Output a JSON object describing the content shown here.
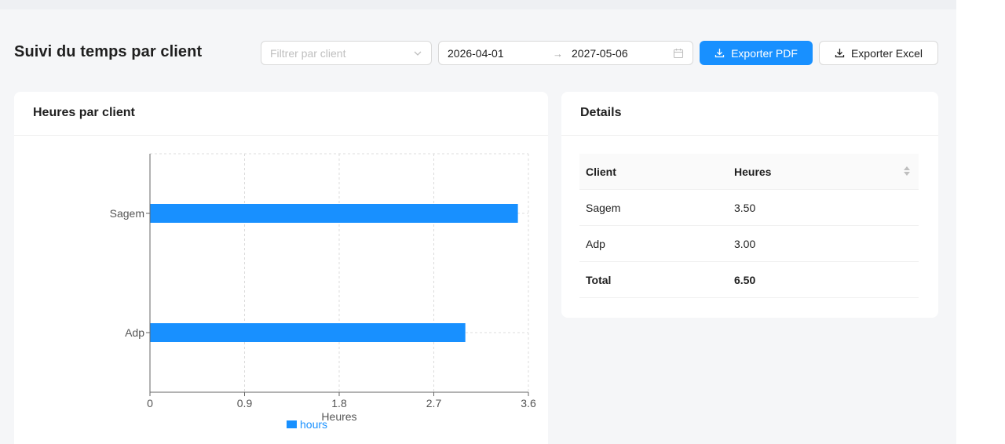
{
  "header": {
    "title": "Suivi du temps par client",
    "client_filter_placeholder": "Filtrer par client",
    "date_start": "2026-04-01",
    "date_end": "2027-05-06",
    "export_pdf_label": "Exporter PDF",
    "export_excel_label": "Exporter Excel"
  },
  "chart_card": {
    "title": "Heures par client"
  },
  "details_card": {
    "title": "Details",
    "columns": [
      "Client",
      "Heures"
    ],
    "rows": [
      {
        "client": "Sagem",
        "hours": "3.50"
      },
      {
        "client": "Adp",
        "hours": "3.00"
      }
    ],
    "total_label": "Total",
    "total_value": "6.50"
  },
  "colors": {
    "primary": "#1890ff",
    "bar": "#1890ff"
  },
  "icons": {
    "filter_chevron": "chevron-down-icon",
    "range_arrow": "arrow-right-icon",
    "range_calendar": "calendar-icon",
    "export_pdf": "download-icon",
    "export_excel": "download-icon",
    "sorter": "sort-icon"
  },
  "chart_data": {
    "type": "bar",
    "orientation": "horizontal",
    "categories": [
      "Sagem",
      "Adp"
    ],
    "series": [
      {
        "name": "hours",
        "values": [
          3.5,
          3.0
        ]
      }
    ],
    "xlabel": "Heures",
    "ylabel": "",
    "xlim": [
      0,
      3.6
    ],
    "xticks": [
      "0",
      "0.9",
      "1.8",
      "2.7",
      "3.6"
    ],
    "grid": true,
    "legend": "bottom"
  }
}
